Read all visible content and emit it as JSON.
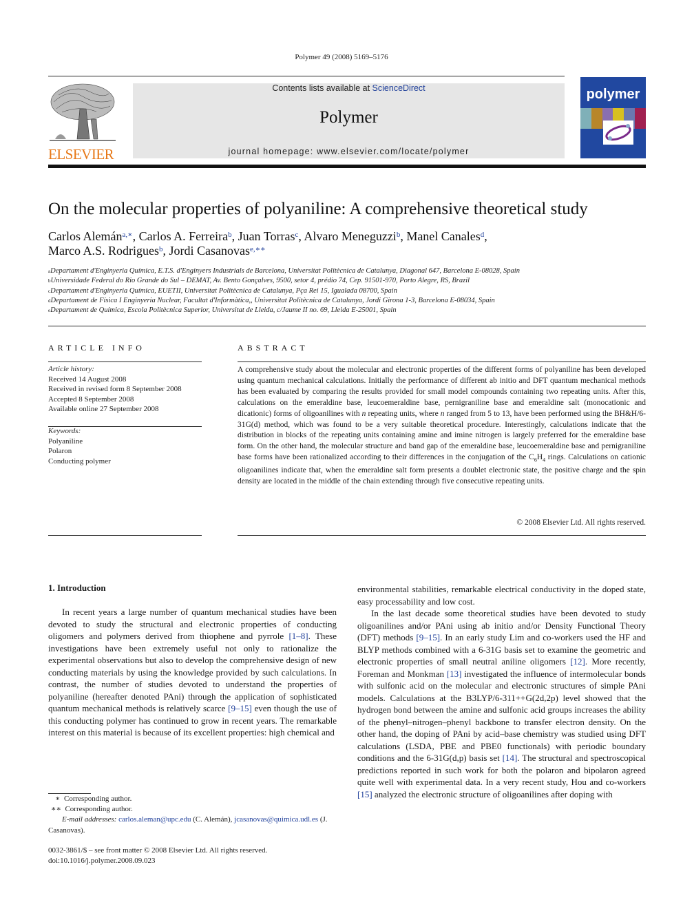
{
  "header": {
    "citation": "Polymer 49 (2008) 5169–5176",
    "contents_prefix": "Contents lists available at ",
    "contents_link": "ScienceDirect",
    "journal_name": "Polymer",
    "homepage": "journal homepage: www.elsevier.com/locate/polymer",
    "publisher_logo_text": "ELSEVIER",
    "cover_title": "polymer",
    "colors": {
      "publisher_orange": "#e77817",
      "link_blue": "#1f3f9a",
      "cover_blue": "#2148a0",
      "banner_gray": "#e6e6e6"
    }
  },
  "article": {
    "title": "On the molecular properties of polyaniline: A comprehensive theoretical study",
    "authors": [
      {
        "name": "Carlos Alemán",
        "marks": "a,∗",
        "sep": ", "
      },
      {
        "name": "Carlos A. Ferreira",
        "marks": "b",
        "sep": ", "
      },
      {
        "name": "Juan Torras",
        "marks": "c",
        "sep": ", "
      },
      {
        "name": "Alvaro Meneguzzi",
        "marks": "b",
        "sep": ", "
      },
      {
        "name": "Manel Canales",
        "marks": "d",
        "sep": ","
      },
      {
        "name": "Marco A.S. Rodrigues",
        "marks": "b",
        "sep": ", "
      },
      {
        "name": "Jordi Casanovas",
        "marks": "e,∗∗",
        "sep": ""
      }
    ],
    "affiliations": [
      {
        "mark": "a",
        "text": "Departament d'Enginyeria Química, E.T.S. d'Enginyers Industrials de Barcelona, Universitat Politècnica de Catalunya, Diagonal 647, Barcelona E-08028, Spain"
      },
      {
        "mark": "b",
        "text": "Universidade Federal do Rio Grande do Sul – DEMAT, Av. Bento Gonçalves, 9500, setor 4, prédio 74, Cep. 91501-970, Porto Alegre, RS, Brazil"
      },
      {
        "mark": "c",
        "text": "Departament d'Enginyeria Química, EUETII, Universitat Politècnica de Catalunya, Pça Rei 15, Igualada 08700, Spain"
      },
      {
        "mark": "d",
        "text": "Departament de Física I Enginyeria Nuclear, Facultat d'Informàtica,, Universitat Politècnica de Catalunya, Jordi Girona 1-3, Barcelona E-08034, Spain"
      },
      {
        "mark": "e",
        "text": "Departament de Química, Escola Politècnica Superior, Universitat de Lleida, c/Jaume II no. 69, Lleida E-25001, Spain"
      }
    ]
  },
  "article_info": {
    "heading": "ARTICLE INFO",
    "history_label": "Article history:",
    "history": [
      "Received 14 August 2008",
      "Received in revised form 8 September 2008",
      "Accepted 8 September 2008",
      "Available online 27 September 2008"
    ],
    "keywords_label": "Keywords:",
    "keywords": [
      "Polyaniline",
      "Polaron",
      "Conducting polymer"
    ]
  },
  "abstract": {
    "heading": "ABSTRACT",
    "part1": "A comprehensive study about the molecular and electronic properties of the different forms of polyaniline has been developed using quantum mechanical calculations. Initially the performance of different ab initio and DFT quantum mechanical methods has been evaluated by comparing the results provided for small model compounds containing two repeating units. After this, calculations on the emeraldine base, leucoemeraldine base, pernigraniline base and emeraldine salt (monocationic and dicationic) forms of oligoanilines with ",
    "n1": "n",
    "part2": " repeating units, where ",
    "n2": "n",
    "part3": " ranged from 5 to 13, have been performed using the BH&H/6-31G(d) method, which was found to be a very suitable theoretical procedure. Interestingly, calculations indicate that the distribution in blocks of the repeating units containing amine and imine nitrogen is largely preferred for the emeraldine base form. On the other hand, the molecular structure and band gap of the emeraldine base, leucoemeraldine base and pernigraniline base forms have been rationalized according to their differences in the conjugation of the C",
    "sub1": "6",
    "h": "H",
    "sub2": "4",
    "part4": " rings. Calculations on cationic oligoanilines indicate that, when the emeraldine salt form presents a doublet electronic state, the positive charge and the spin density are located in the middle of the chain extending through five consecutive repeating units.",
    "copyright": "© 2008 Elsevier Ltd. All rights reserved."
  },
  "introduction": {
    "heading": "1.  Introduction",
    "col1": [
      {
        "t": "In recent years a large number of quantum mechanical studies have been devoted to study the structural and electronic properties of conducting oligomers and polymers derived from thiophene and pyrrole "
      },
      {
        "ref": "[1–8]"
      },
      {
        "t": ". These investigations have been extremely useful not only to rationalize the experimental observations but also to develop the comprehensive design of new conducting materials by using the knowledge provided by such calculations. In contrast, the number of studies devoted to understand the properties of polyaniline (hereafter denoted PAni) through the application of sophisticated quantum mechanical methods is relatively scarce "
      },
      {
        "ref": "[9–15]"
      },
      {
        "t": " even though the use of this conducting polymer has continued to grow in recent years. The remarkable interest on this material is because of its excellent properties: high chemical and"
      }
    ],
    "col2_p1": "environmental stabilities, remarkable electrical conductivity in the doped state, easy processability and low cost.",
    "col2_p2": [
      {
        "t": "In the last decade some theoretical studies have been devoted to study oligoanilines and/or PAni using ab initio and/or Density Functional Theory (DFT) methods "
      },
      {
        "ref": "[9–15]"
      },
      {
        "t": ". In an early study Lim and co-workers used the HF and BLYP methods combined with a 6-31G basis set to examine the geometric and electronic properties of small neutral aniline oligomers "
      },
      {
        "ref": "[12]"
      },
      {
        "t": ". More recently, Foreman and Monkman "
      },
      {
        "ref": "[13]"
      },
      {
        "t": " investigated the influence of intermolecular bonds with sulfonic acid on the molecular and electronic structures of simple PAni models. Calculations at the B3LYP/6-311++G(2d,2p) level showed that the hydrogen bond between the amine and sulfonic acid groups increases the ability of the phenyl–nitrogen–phenyl backbone to transfer electron density. On the other hand, the doping of PAni by acid–base chemistry was studied using DFT calculations (LSDA, PBE and PBE0 functionals) with periodic boundary conditions and the 6-31G(d,p) basis set "
      },
      {
        "ref": "[14]"
      },
      {
        "t": ". The structural and spectroscopical predictions reported in such work for both the polaron and bipolaron agreed quite well with experimental data. In a very recent study, Hou and co-workers "
      },
      {
        "ref": "[15]"
      },
      {
        "t": " analyzed the electronic structure of oligoanilines after doping with"
      }
    ]
  },
  "footnotes": {
    "fn1_mark": "∗",
    "fn1": "Corresponding author.",
    "fn2_mark": "∗∗",
    "fn2": "Corresponding author.",
    "email_label": "E-mail addresses:",
    "email1": "carlos.aleman@upc.edu",
    "email1_who": " (C. Alemán), ",
    "email2": "jcasanovas@quimica.udl.es",
    "email2_who": " (J. Casanovas)."
  },
  "front_matter": {
    "issn_line": "0032-3861/$ – see front matter © 2008 Elsevier Ltd. All rights reserved.",
    "doi": "doi:10.1016/j.polymer.2008.09.023"
  }
}
